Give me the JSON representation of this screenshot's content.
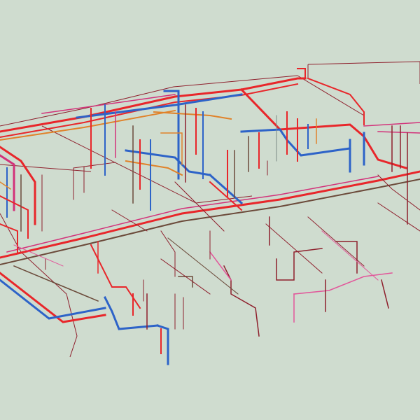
{
  "view": {
    "background": "#cfdccf"
  },
  "legend": {
    "colors": {
      "red": "#e8262a",
      "blue": "#2d63c8",
      "orange": "#e0822a",
      "magenta": "#d2327a",
      "brown": "#6b4a3a",
      "dark_red": "#8e1f2c",
      "gray": "#7b8a86",
      "pink": "#e2569a",
      "teal": "#4f7f86"
    }
  }
}
